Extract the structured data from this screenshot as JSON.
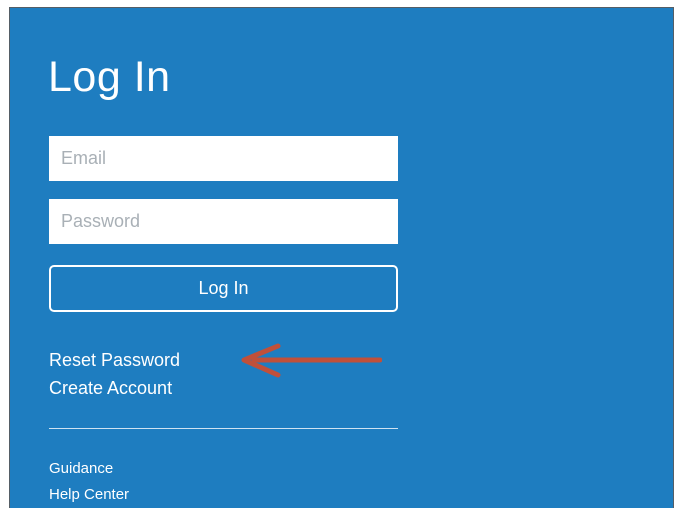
{
  "login": {
    "title": "Log In",
    "email_placeholder": "Email",
    "password_placeholder": "Password",
    "login_button": "Log In"
  },
  "links": {
    "reset_password": "Reset Password",
    "create_account": "Create Account"
  },
  "footer_links": {
    "guidance": "Guidance",
    "help_center": "Help Center"
  },
  "colors": {
    "panel_background": "#1e7dc0",
    "annotation_arrow": "#c0503a"
  },
  "icons": {
    "annotation": "arrow-left-icon"
  }
}
